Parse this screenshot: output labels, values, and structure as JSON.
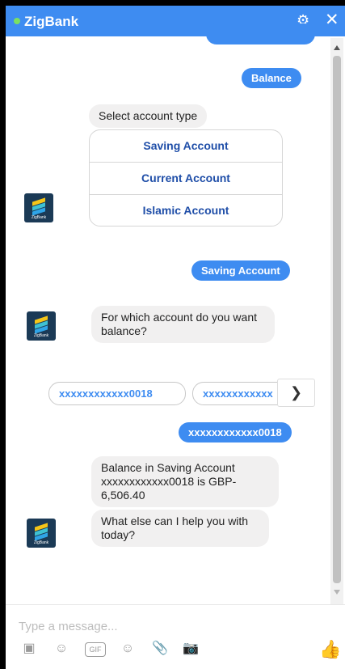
{
  "header": {
    "title": "ZigBank",
    "settings_icon": "gear-icon",
    "close_icon": "close-icon"
  },
  "messages": {
    "balance_request": "Balance",
    "select_account_prompt": "Select account type",
    "account_options": [
      "Saving Account",
      "Current Account",
      "Islamic Account"
    ],
    "saving_reply": "Saving Account",
    "which_account_prompt": "For which account do you want balance?",
    "account_chips": [
      "xxxxxxxxxxxx0018",
      "xxxxxxxxxxxx"
    ],
    "selected_account": "xxxxxxxxxxxx0018",
    "balance_info": "Balance in Saving Account xxxxxxxxxxxx0018 is GBP-6,506.40",
    "followup": "What else can I help you with today?"
  },
  "bot": {
    "logo_text": "ZigBank"
  },
  "composer": {
    "placeholder": "Type a message...",
    "gif_label": "GIF"
  },
  "colors": {
    "accent": "#3e8cf1",
    "bubble_gray": "#f1f0f0",
    "option_text": "#1f4ea8"
  }
}
